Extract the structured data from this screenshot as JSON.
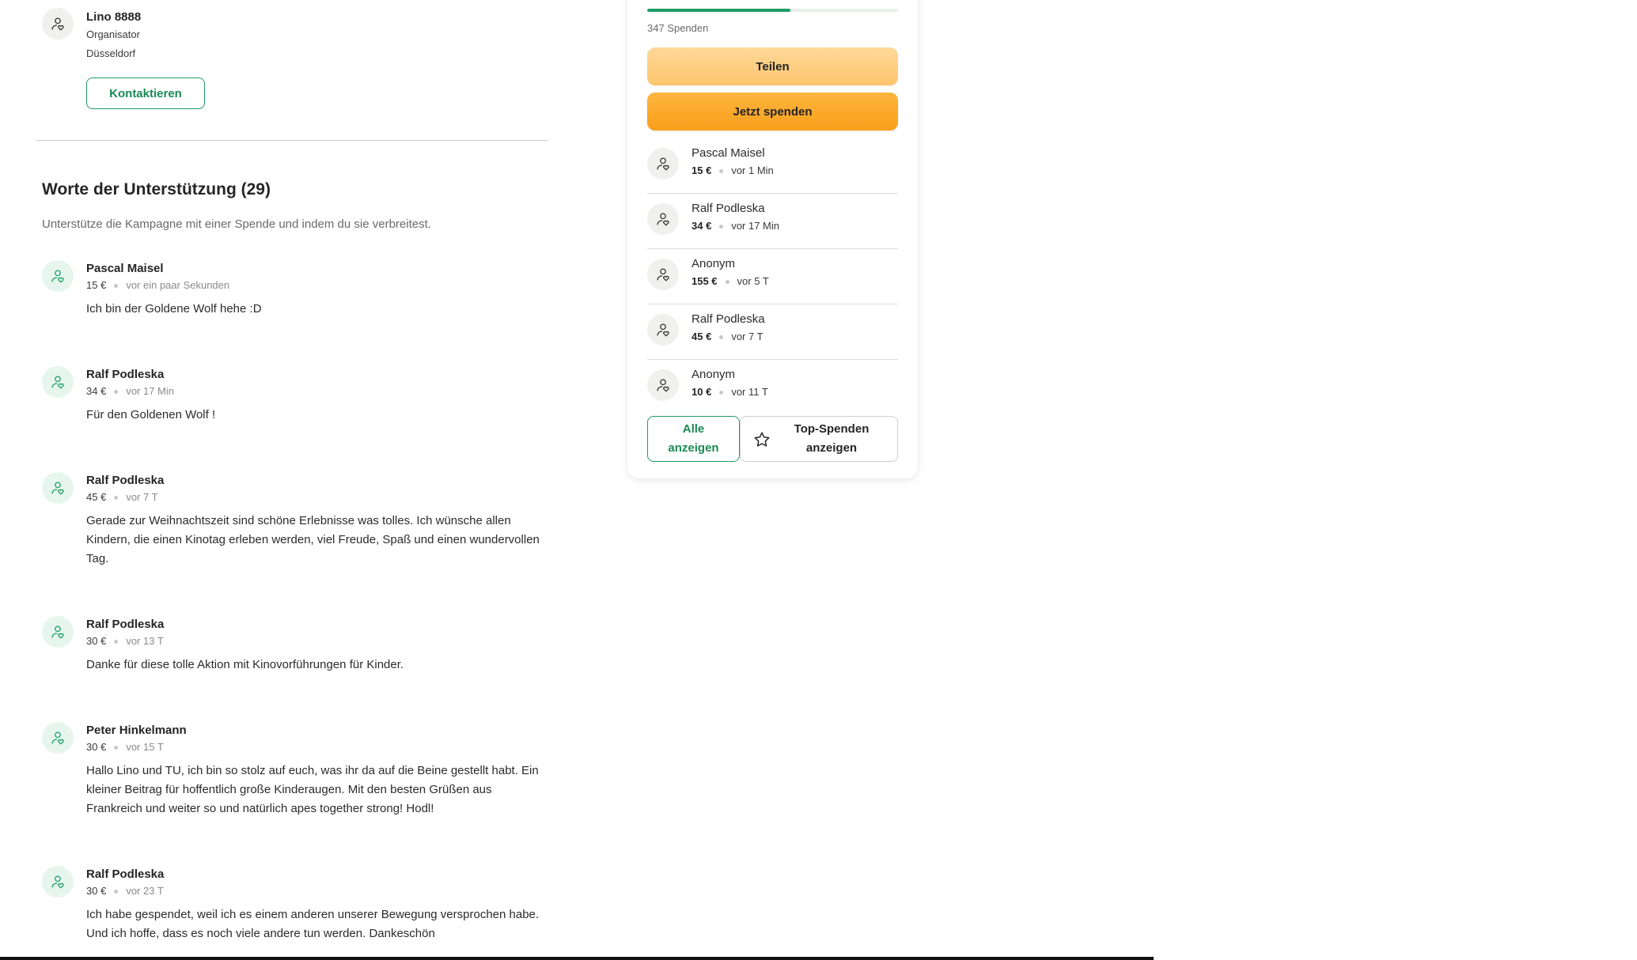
{
  "organizer": {
    "name": "Lino 8888",
    "role": "Organisator",
    "city": "Düsseldorf",
    "contact_label": "Kontaktieren"
  },
  "support": {
    "title": "Worte der Unterstützung (29)",
    "subtitle": "Unterstütze die Kampagne mit einer Spende und indem du sie verbreitest.",
    "comments": [
      {
        "name": "Pascal Maisel",
        "amount": "15 €",
        "time": "vor ein paar Sekunden",
        "text": "Ich bin der Goldene Wolf hehe :D"
      },
      {
        "name": "Ralf Podleska",
        "amount": "34 €",
        "time": "vor 17 Min",
        "text": "Für den Goldenen Wolf !"
      },
      {
        "name": "Ralf Podleska",
        "amount": "45 €",
        "time": "vor 7 T",
        "text": "Gerade zur Weihnachtszeit sind schöne Erlebnisse was tolles. Ich wünsche allen Kindern, die einen Kinotag erleben werden, viel Freude, Spaß und einen wundervollen Tag."
      },
      {
        "name": "Ralf Podleska",
        "amount": "30 €",
        "time": "vor 13 T",
        "text": "Danke für diese tolle Aktion mit Kinovorführungen für Kinder."
      },
      {
        "name": "Peter Hinkelmann",
        "amount": "30 €",
        "time": "vor 15 T",
        "text": "Hallo Lino und TU, ich bin so stolz auf euch, was ihr da auf die Beine gestellt habt. Ein kleiner Beitrag für hoffentlich große Kinderaugen. Mit den besten Grüßen aus Frankreich und weiter so und natürlich apes together strong! Hodl!"
      },
      {
        "name": "Ralf Podleska",
        "amount": "30 €",
        "time": "vor 23 T",
        "text": "Ich habe gespendet, weil ich es einem anderen unserer Bewegung versprochen habe. Und ich hoffe, dass es noch viele andere tun werden. Dankeschön"
      }
    ]
  },
  "card": {
    "progress_fraction": 0.57,
    "donation_count": "347 Spenden",
    "share_label": "Teilen",
    "donate_label": "Jetzt spenden",
    "donors": [
      {
        "name": "Pascal Maisel",
        "amount": "15 €",
        "time": "vor 1 Min"
      },
      {
        "name": "Ralf Podleska",
        "amount": "34 €",
        "time": "vor 17 Min"
      },
      {
        "name": "Anonym",
        "amount": "155 €",
        "time": "vor 5 T"
      },
      {
        "name": "Ralf Podleska",
        "amount": "45 €",
        "time": "vor 7 T"
      },
      {
        "name": "Anonym",
        "amount": "10 €",
        "time": "vor 11 T"
      }
    ],
    "show_all_label": "Alle anzeigen",
    "top_donations_label": "Top-Spenden anzeigen",
    "top_icon": "star-icon"
  },
  "colors": {
    "accent_green": "#1f9d63",
    "share_orange": "#fdc46c",
    "donate_orange": "#f99f1b"
  },
  "icons": {
    "avatar": "user-heart-icon"
  }
}
